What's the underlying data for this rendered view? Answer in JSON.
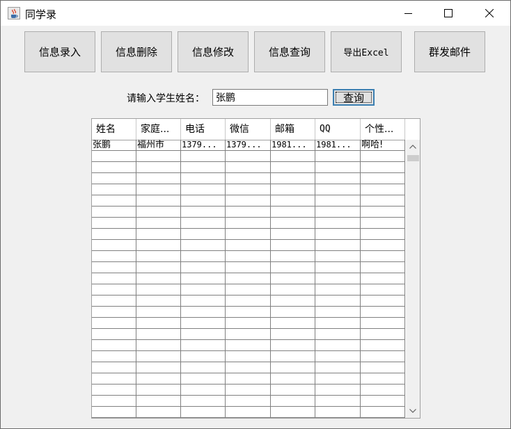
{
  "window": {
    "title": "同学录",
    "icon": "java-coffee-icon"
  },
  "toolbar": {
    "buttons": [
      "信息录入",
      "信息删除",
      "信息修改",
      "信息查询",
      "导出Excel",
      "群发邮件"
    ]
  },
  "search": {
    "label": "请输入学生姓名：",
    "value": "张鹏",
    "button": "查询"
  },
  "table": {
    "columns": [
      "姓名",
      "家庭...",
      "电话",
      "微信",
      "邮箱",
      "QQ",
      "个性..."
    ],
    "rows": [
      [
        "张鹏",
        "福州市",
        "1379...",
        "1379...",
        "1981...",
        "1981...",
        "啊哈!"
      ]
    ]
  },
  "colors": {
    "background": "#f0f0f0",
    "titlebar": "#ffffff",
    "button_face": "#e1e1e1",
    "focus_border": "#3c7fb1"
  }
}
